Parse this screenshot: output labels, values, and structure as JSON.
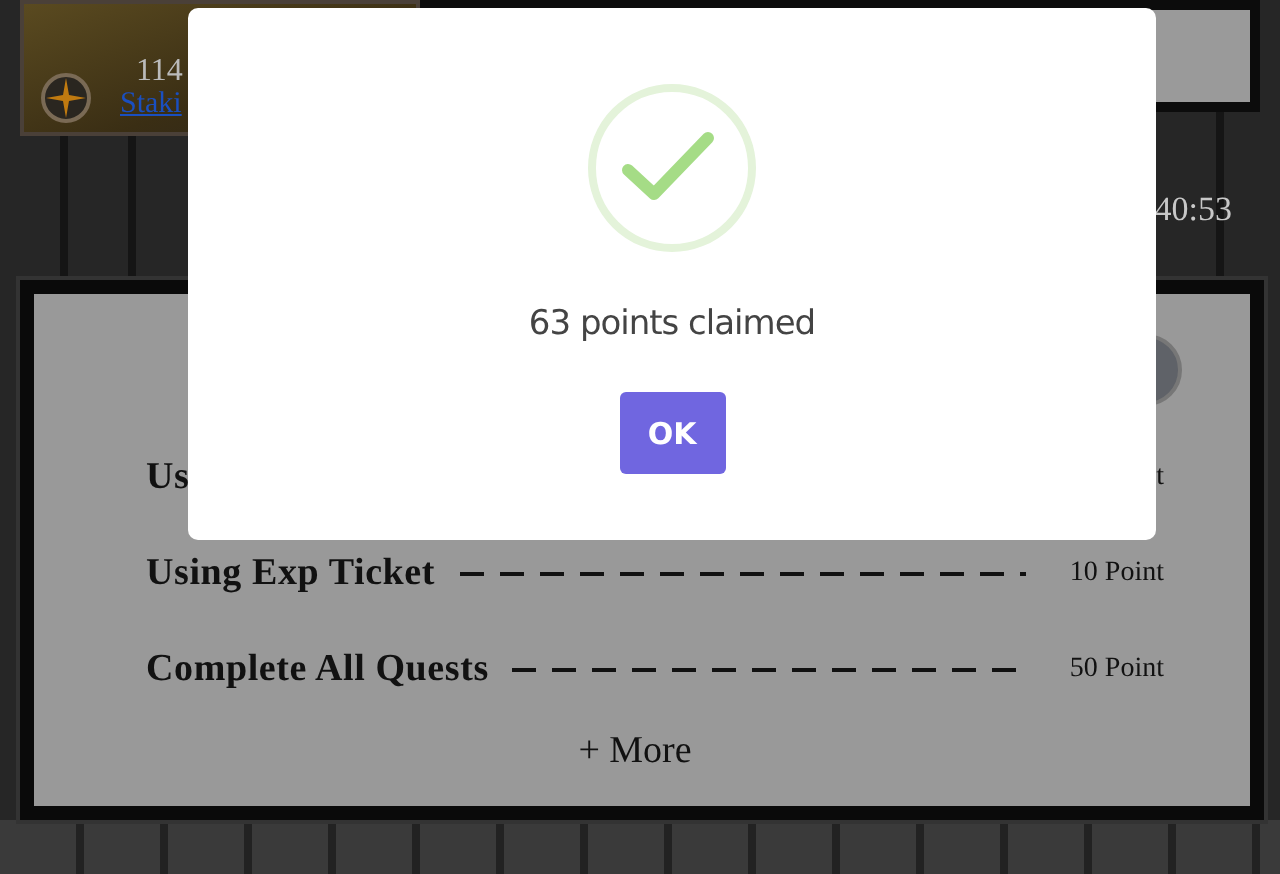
{
  "card": {
    "level_text": "114",
    "name_link": "Staki"
  },
  "timer": "40:53",
  "rewards": [
    {
      "label": "Us",
      "points": "t"
    },
    {
      "label": "Using Exp Ticket",
      "points": "10 Point"
    },
    {
      "label": "Complete All Quests",
      "points": "50 Point"
    }
  ],
  "more_link": "+ More",
  "dialog": {
    "message": "63 points claimed",
    "button": "OK"
  }
}
